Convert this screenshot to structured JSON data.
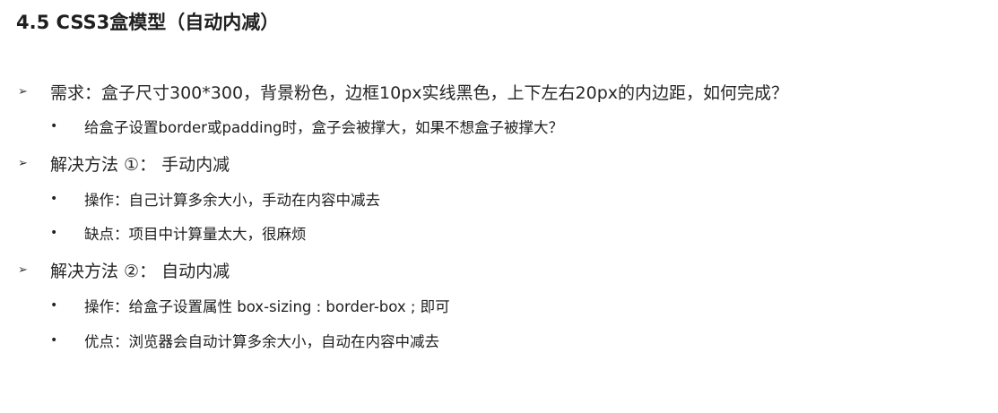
{
  "title": "4.5 CSS3盒模型（自动内减）",
  "markers": {
    "level1": "➢",
    "level2": "•"
  },
  "items": [
    {
      "level": 1,
      "text": "需求：盒子尺寸300*300，背景粉色，边框10px实线黑色，上下左右20px的内边距，如何完成？"
    },
    {
      "level": 2,
      "text": "给盒子设置border或padding时，盒子会被撑大，如果不想盒子被撑大？"
    },
    {
      "level": 1,
      "text": "解决方法 ①： 手动内减"
    },
    {
      "level": 2,
      "text": "操作：自己计算多余大小，手动在内容中减去"
    },
    {
      "level": 2,
      "text": "缺点：项目中计算量太大，很麻烦"
    },
    {
      "level": 1,
      "text": "解决方法 ②： 自动内减"
    },
    {
      "level": 2,
      "text": "操作：给盒子设置属性 box-sizing : border-box ; 即可"
    },
    {
      "level": 2,
      "text": "优点：浏览器会自动计算多余大小，自动在内容中减去"
    }
  ]
}
